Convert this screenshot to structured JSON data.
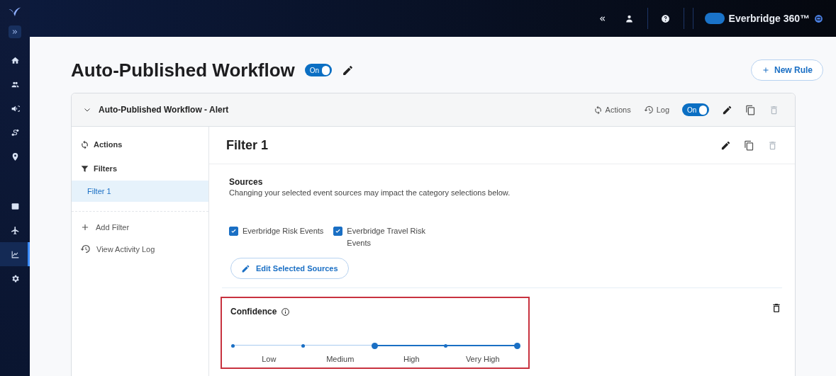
{
  "nav": {
    "items": [
      {
        "selected": false
      },
      {
        "selected": false
      },
      {
        "selected": false
      },
      {
        "selected": false
      },
      {
        "selected": false
      },
      {
        "selected": false
      },
      {
        "selected": false
      },
      {
        "selected": true
      },
      {
        "selected": false
      }
    ]
  },
  "topbar": {
    "product": "Everbridge 360™",
    "product_toggle_on": true
  },
  "page": {
    "title": "Auto-Published Workflow",
    "toggle": {
      "label": "On",
      "on": true
    },
    "new_rule": "New Rule"
  },
  "rule": {
    "title": "Auto-Published Workflow - Alert",
    "expanded": true,
    "actions": "Actions",
    "log": "Log",
    "toggle": {
      "label": "On",
      "on": true
    }
  },
  "menu": {
    "actions": "Actions",
    "filters": "Filters",
    "items": [
      {
        "label": "Filter 1",
        "selected": true
      }
    ],
    "add": "Add Filter",
    "activity": "View Activity Log"
  },
  "filter": {
    "title": "Filter 1",
    "sources": {
      "heading": "Sources",
      "note": "Changing your selected event sources may impact the category selections below.",
      "options": [
        {
          "label": "Everbridge Risk Events",
          "checked": true
        },
        {
          "label": "Everbridge Travel Risk Events",
          "checked": true
        }
      ],
      "edit": "Edit Selected Sources"
    },
    "confidence": {
      "heading": "Confidence",
      "segments": [
        {
          "label": "Low",
          "selected": false
        },
        {
          "label": "Medium",
          "selected": false
        },
        {
          "label": "High",
          "selected": true
        },
        {
          "label": "Very High",
          "selected": true
        }
      ]
    }
  }
}
